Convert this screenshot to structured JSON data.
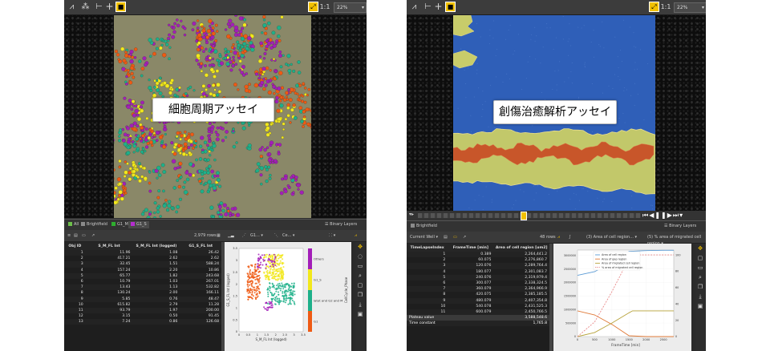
{
  "left_panel": {
    "zoom_level": "22%",
    "image_caption": "細胞周期アッセイ",
    "tabs": [
      {
        "label": "All",
        "color": "#6dbf4a"
      },
      {
        "label": "Brightfield",
        "color": "#8a8a8a"
      },
      {
        "label": "G1_M",
        "color": "#2eae2e"
      },
      {
        "label": "G1_S",
        "color": "#b52ccf"
      }
    ],
    "binary_layers_label": "Binary Layers",
    "row_count": "2,979 rows",
    "dropdowns": [
      "G1...",
      "Ce..."
    ],
    "table": {
      "headers": [
        "Obj ID",
        "S_M_FL Int",
        "S_M_FL Int (logged)",
        "G1_S_FL Int"
      ],
      "rows": [
        [
          "1",
          "11.96",
          "1.08",
          "26.42"
        ],
        [
          "2",
          "417.21",
          "2.62",
          "2.62"
        ],
        [
          "3",
          "32.45",
          "1.51",
          "588.24"
        ],
        [
          "4",
          "157.24",
          "2.20",
          "10.86"
        ],
        [
          "5",
          "65.77",
          "1.82",
          "243.68"
        ],
        [
          "6",
          "10.79",
          "1.03",
          "267.01"
        ],
        [
          "7",
          "13.43",
          "1.13",
          "532.82"
        ],
        [
          "8",
          "130.24",
          "2.00",
          "166.11"
        ],
        [
          "9",
          "5.85",
          "0.76",
          "48.47"
        ],
        [
          "10",
          "615.82",
          "2.79",
          "11.28"
        ],
        [
          "11",
          "93.79",
          "1.97",
          "200.00"
        ],
        [
          "12",
          "3.15",
          "0.50",
          "91.45"
        ],
        [
          "13",
          "7.24",
          "0.86",
          "126.68"
        ]
      ]
    },
    "scatter": {
      "ylabel": "G1_S_FL Int (logged)",
      "xlabel": "S_M_FL Int (logged)",
      "x_ticks": [
        "0",
        "0.5",
        "1",
        "1.5",
        "2",
        "2.5",
        "3",
        "3.5"
      ],
      "y_ticks": [
        "0",
        "0.5",
        "1",
        "1.5",
        "2",
        "2.5",
        "3",
        "3.5"
      ],
      "legend_title": "CellCycle_Phase",
      "legend": [
        {
          "label": "Others",
          "color": "#a31fb8"
        },
        {
          "label": "G1_S",
          "color": "#f2e81c"
        },
        {
          "label": "latet and G2 and M",
          "color": "#1eb08a"
        },
        {
          "label": "G1",
          "color": "#ef5a14"
        }
      ]
    }
  },
  "right_panel": {
    "zoom_level": "22%",
    "image_caption": "創傷治癒解析アッセイ",
    "tabs": [
      {
        "label": "Brightfield",
        "color": "#8a8a8a"
      }
    ],
    "binary_layers_label": "Binary Layers",
    "current_well_label": "Current Well",
    "row_count": "48 rows",
    "dropdowns": [
      "(3) Area of cell region...",
      "(5) % area of migrated cell region"
    ],
    "table": {
      "headers": [
        "TimeLapseIndex",
        "FrameTime [min]",
        "Area of cell region [um2]"
      ],
      "rows": [
        [
          "1",
          "0.389",
          "2,264,441.2"
        ],
        [
          "2",
          "60.075",
          "2,276,860.7"
        ],
        [
          "3",
          "120.076",
          "2,289,764.4"
        ],
        [
          "4",
          "180.077",
          "2,301,083.7"
        ],
        [
          "5",
          "240.076",
          "2,319,979.4"
        ],
        [
          "6",
          "300.077",
          "2,338,324.5"
        ],
        [
          "7",
          "360.079",
          "2,364,966.9"
        ],
        [
          "8",
          "420.075",
          "2,385,185.5"
        ],
        [
          "9",
          "480.079",
          "2,407,354.8"
        ],
        [
          "10",
          "540.078",
          "2,431,525.3"
        ],
        [
          "11",
          "600.079",
          "2,450,766.5"
        ]
      ],
      "summary": [
        [
          "Plateau value",
          "",
          "3,588,548.6"
        ],
        [
          "Time constant",
          "",
          "1,765.8"
        ]
      ]
    },
    "chart_data": {
      "type": "line",
      "xlabel": "FrameTime [min]",
      "x_ticks": [
        "0",
        "500",
        "1000",
        "1500",
        "2000",
        "2500"
      ],
      "left_y_ticks": [
        "0",
        "500000",
        "1000000",
        "1500000",
        "2000000",
        "2500000",
        "3000000"
      ],
      "right_y_ticks": [
        "0",
        "20",
        "40",
        "60",
        "80",
        "100"
      ],
      "xlim": [
        0,
        2800
      ],
      "ylim_left": [
        0,
        3200000
      ],
      "ylim_right": [
        0,
        106
      ],
      "series": [
        {
          "name": "Area of cell region",
          "axis": "left",
          "style": "solid",
          "color": "#5b9bd5",
          "x": [
            0,
            500,
            1000,
            1500,
            2000,
            2500,
            2800
          ],
          "y": [
            2264441,
            2400000,
            2750000,
            3150000,
            3180000,
            3190000,
            3190000
          ]
        },
        {
          "name": "Area of gap region",
          "axis": "left",
          "style": "solid",
          "color": "#e07b39",
          "x": [
            0,
            500,
            1000,
            1500,
            2000,
            2500,
            2800
          ],
          "y": [
            950000,
            800000,
            450000,
            30000,
            0,
            0,
            0
          ]
        },
        {
          "name": "Area of migrated cell region",
          "axis": "left",
          "style": "solid",
          "color": "#b7a23a",
          "x": [
            0,
            500,
            1000,
            1500,
            1600,
            2000,
            2800
          ],
          "y": [
            0,
            150000,
            500000,
            880000,
            950000,
            950000,
            950000
          ]
        },
        {
          "name": "% area of migrated cell region",
          "axis": "right",
          "style": "dashed",
          "color": "#e88a8a",
          "x": [
            0,
            500,
            1000,
            1500,
            1600,
            2800
          ],
          "y": [
            0,
            18,
            55,
            96,
            100,
            100
          ]
        }
      ]
    }
  }
}
